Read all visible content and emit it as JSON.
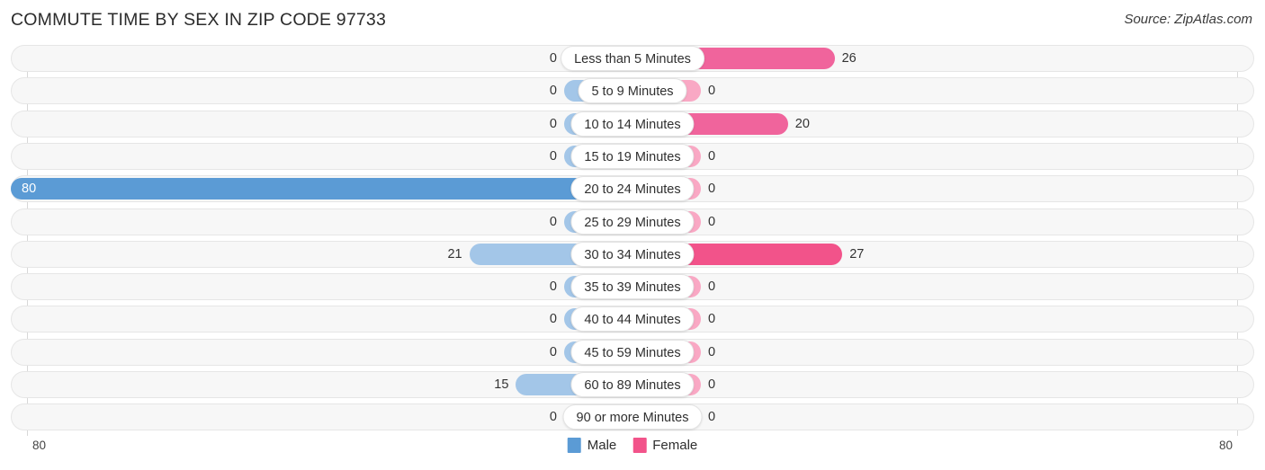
{
  "header": {
    "title": "COMMUTE TIME BY SEX IN ZIP CODE 97733",
    "source": "Source: ZipAtlas.com"
  },
  "legend": {
    "male_label": "Male",
    "female_label": "Female",
    "male_color": "#5b9bd5",
    "female_color": "#f2538a"
  },
  "axis": {
    "left_tick": "80",
    "right_tick": "80",
    "max": 80
  },
  "colors": {
    "male_max": "#5b9bd5",
    "male_normal": "#a3c6e8",
    "female_max": "#f2538a",
    "female_high": "#f0649c",
    "female_normal": "#f9a8c4",
    "track_fill": "#f7f7f7",
    "track_border": "#e6e6e6"
  },
  "chart_data": {
    "type": "bar",
    "title": "COMMUTE TIME BY SEX IN ZIP CODE 97733",
    "orientation": "horizontal-diverging",
    "xlabel": "",
    "ylabel": "",
    "xlim": [
      80,
      80
    ],
    "grid": false,
    "legend_position": "bottom-center",
    "categories": [
      "Less than 5 Minutes",
      "5 to 9 Minutes",
      "10 to 14 Minutes",
      "15 to 19 Minutes",
      "20 to 24 Minutes",
      "25 to 29 Minutes",
      "30 to 34 Minutes",
      "35 to 39 Minutes",
      "40 to 44 Minutes",
      "45 to 59 Minutes",
      "60 to 89 Minutes",
      "90 or more Minutes"
    ],
    "series": [
      {
        "name": "Male",
        "values": [
          0,
          0,
          0,
          0,
          80,
          0,
          21,
          0,
          0,
          0,
          15,
          0
        ]
      },
      {
        "name": "Female",
        "values": [
          26,
          0,
          20,
          0,
          0,
          0,
          27,
          0,
          0,
          0,
          0,
          0
        ]
      }
    ]
  },
  "rows": [
    {
      "label": "Less than 5 Minutes",
      "male": "0",
      "female": "26"
    },
    {
      "label": "5 to 9 Minutes",
      "male": "0",
      "female": "0"
    },
    {
      "label": "10 to 14 Minutes",
      "male": "0",
      "female": "20"
    },
    {
      "label": "15 to 19 Minutes",
      "male": "0",
      "female": "0"
    },
    {
      "label": "20 to 24 Minutes",
      "male": "80",
      "female": "0"
    },
    {
      "label": "25 to 29 Minutes",
      "male": "0",
      "female": "0"
    },
    {
      "label": "30 to 34 Minutes",
      "male": "21",
      "female": "27"
    },
    {
      "label": "35 to 39 Minutes",
      "male": "0",
      "female": "0"
    },
    {
      "label": "40 to 44 Minutes",
      "male": "0",
      "female": "0"
    },
    {
      "label": "45 to 59 Minutes",
      "male": "0",
      "female": "0"
    },
    {
      "label": "60 to 89 Minutes",
      "male": "15",
      "female": "0"
    },
    {
      "label": "90 or more Minutes",
      "male": "0",
      "female": "0"
    }
  ]
}
